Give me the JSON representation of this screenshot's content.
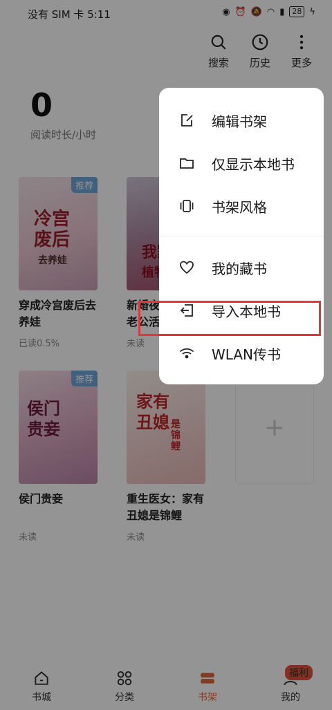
{
  "status": {
    "carrier": "没有 SIM 卡 5:11",
    "battery": "28"
  },
  "top_actions": [
    {
      "label": "搜索",
      "icon": "search-icon"
    },
    {
      "label": "历史",
      "icon": "clock-icon"
    },
    {
      "label": "更多",
      "icon": "more-vertical-icon"
    }
  ],
  "reading": {
    "value": "0",
    "label": "阅读时长/小时"
  },
  "books": [
    {
      "title": "穿成冷宫废后去养娃",
      "progress": "已读0.5%",
      "badge": "推荐",
      "cover_text": "冷宫废后",
      "cover_sub": "去养娃"
    },
    {
      "title": "新婚夜，植物人老公活了植",
      "progress": "未读",
      "badge": "",
      "cover_text": "我家",
      "cover_sub": "植物"
    },
    {
      "title": "侯门贵妾",
      "progress": "未读",
      "badge": "推荐",
      "cover_text": "侯门贵妾",
      "cover_sub": ""
    },
    {
      "title": "重生医女：家有丑媳是锦鲤",
      "progress": "未读",
      "badge": "",
      "cover_text": "家有丑媳",
      "cover_sub": "是锦鲤"
    }
  ],
  "add_slot": {
    "icon": "plus-icon"
  },
  "menu": [
    {
      "label": "编辑书架",
      "icon": "edit-icon"
    },
    {
      "label": "仅显示本地书",
      "icon": "folder-icon"
    },
    {
      "label": "书架风格",
      "icon": "layout-icon"
    },
    {
      "label": "我的藏书",
      "icon": "heart-icon"
    },
    {
      "label": "导入本地书",
      "icon": "import-icon"
    },
    {
      "label": "WLAN传书",
      "icon": "wifi-icon"
    }
  ],
  "bottom_nav": [
    {
      "label": "书城",
      "icon": "home-icon",
      "active": false
    },
    {
      "label": "分类",
      "icon": "grid-icon",
      "active": false
    },
    {
      "label": "书架",
      "icon": "bookshelf-icon",
      "active": true
    },
    {
      "label": "我的",
      "icon": "profile-icon",
      "active": false,
      "badge": "福利"
    }
  ],
  "colors": {
    "accent": "#e06a3a",
    "highlight": "#e0393a",
    "badge_blue": "#6fa6d8"
  }
}
